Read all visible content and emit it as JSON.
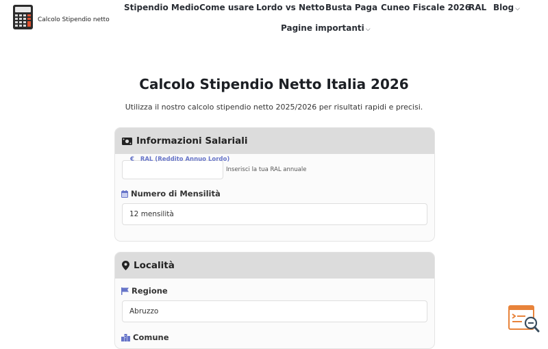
{
  "header": {
    "logo_text": "Calcolo Stipendio netto",
    "nav": [
      {
        "label": "Stipendio Medio"
      },
      {
        "label": "Come usare"
      },
      {
        "label": "Lordo vs Netto"
      },
      {
        "label": "Busta Paga"
      },
      {
        "label": "Cuneo Fiscale 2026"
      },
      {
        "label": "RAL"
      },
      {
        "label": "Blog",
        "has_dropdown": true
      },
      {
        "label": "Pagine importanti",
        "has_dropdown": true
      }
    ]
  },
  "page": {
    "title": "Calcolo Stipendio Netto Italia 2026",
    "subtitle": "Utilizza il nostro calcolo stipendio netto 2025/2026 per risultati rapidi e precisi."
  },
  "salary_card": {
    "title": "Informazioni Salariali",
    "icon": "money-icon",
    "ral": {
      "currency": "€",
      "label": "RAL (Reddito Annuo Lordo)",
      "value": "",
      "hint": "Inserisci la tua RAL annuale"
    },
    "months": {
      "label": "Numero di Mensilità",
      "icon": "calendar-icon",
      "value": "12 mensilità"
    }
  },
  "location_card": {
    "title": "Località",
    "icon": "map-pin-icon",
    "region": {
      "label": "Regione",
      "icon": "flag-icon",
      "value": "Abruzzo"
    },
    "city": {
      "label": "Comune",
      "icon": "city-icon"
    }
  },
  "colors": {
    "accent": "#6674c8",
    "card_header": "#dcdcdc",
    "widget": "#e8833a"
  }
}
